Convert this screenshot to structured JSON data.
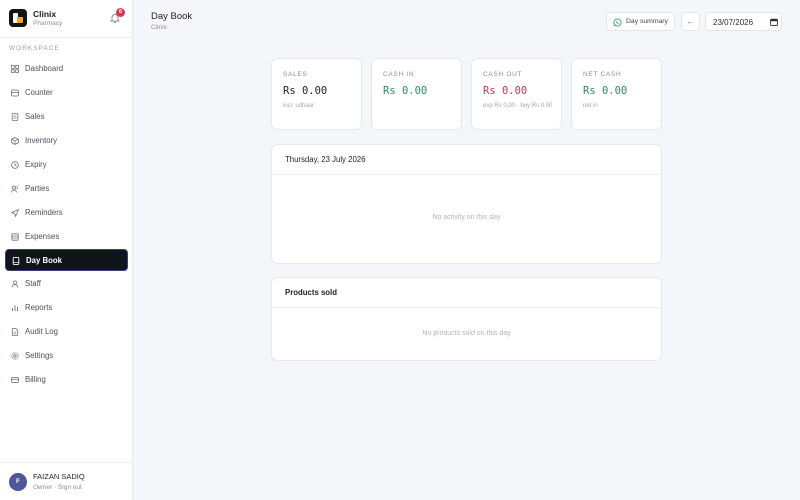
{
  "brand": {
    "name": "Clinix",
    "subtitle": "Pharmacy",
    "notification_count": "6"
  },
  "sidebar": {
    "section_label": "WORKSPACE",
    "items": [
      {
        "label": "Dashboard",
        "icon": "grid-icon"
      },
      {
        "label": "Counter",
        "icon": "register-icon"
      },
      {
        "label": "Sales",
        "icon": "receipt-icon"
      },
      {
        "label": "Inventory",
        "icon": "box-icon"
      },
      {
        "label": "Expiry",
        "icon": "clock-icon"
      },
      {
        "label": "Parties",
        "icon": "people-icon"
      },
      {
        "label": "Reminders",
        "icon": "send-icon"
      },
      {
        "label": "Expenses",
        "icon": "stack-icon"
      },
      {
        "label": "Day Book",
        "icon": "book-icon",
        "active": true
      },
      {
        "label": "Staff",
        "icon": "staff-icon"
      },
      {
        "label": "Reports",
        "icon": "bar-chart-icon"
      },
      {
        "label": "Audit Log",
        "icon": "document-icon"
      },
      {
        "label": "Settings",
        "icon": "gear-icon"
      },
      {
        "label": "Billing",
        "icon": "card-icon"
      }
    ]
  },
  "user": {
    "initial": "F",
    "name": "FAIZAN SADIQ",
    "role_line": "Owner · Sign out"
  },
  "header": {
    "title": "Day Book",
    "subtitle": "Clinix",
    "whatsapp_label": "Day summary",
    "back_arrow": "←",
    "date_value": "23/07/2026"
  },
  "cards": [
    {
      "label": "SALES",
      "value": "Rs 0.00",
      "note": "incl. udhaar",
      "color": "#1c1f2a"
    },
    {
      "label": "CASH IN",
      "value": "Rs 0.00",
      "note": "",
      "color": "#2e8f5e"
    },
    {
      "label": "CASH OUT",
      "value": "Rs 0.00",
      "note": "exp Rs 0.00 · buy Rs 0.00",
      "color": "#c23a57"
    },
    {
      "label": "NET CASH",
      "value": "Rs 0.00",
      "note": "net in",
      "color": "#2e8f5e"
    }
  ],
  "activity_panel": {
    "title": "Thursday, 23 July 2026",
    "empty_text": "No activity on this day"
  },
  "products_panel": {
    "title": "Products sold",
    "empty_text": "No products sold on this day"
  },
  "colors": {
    "accent_dark": "#12141c",
    "badge": "#e0345c",
    "whatsapp": "#25a95a"
  }
}
